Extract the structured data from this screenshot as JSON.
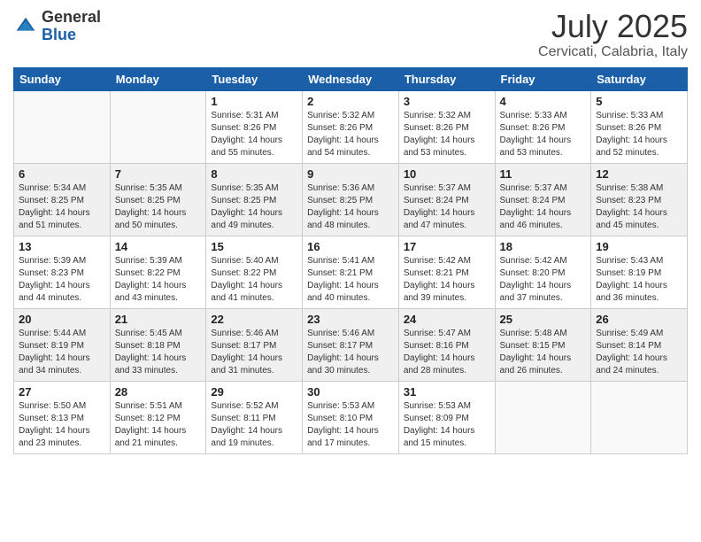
{
  "header": {
    "logo_general": "General",
    "logo_blue": "Blue",
    "month": "July 2025",
    "location": "Cervicati, Calabria, Italy"
  },
  "weekdays": [
    "Sunday",
    "Monday",
    "Tuesday",
    "Wednesday",
    "Thursday",
    "Friday",
    "Saturday"
  ],
  "weeks": [
    [
      {
        "day": "",
        "empty": true
      },
      {
        "day": "",
        "empty": true
      },
      {
        "day": "1",
        "sunrise": "5:31 AM",
        "sunset": "8:26 PM",
        "daylight": "14 hours and 55 minutes."
      },
      {
        "day": "2",
        "sunrise": "5:32 AM",
        "sunset": "8:26 PM",
        "daylight": "14 hours and 54 minutes."
      },
      {
        "day": "3",
        "sunrise": "5:32 AM",
        "sunset": "8:26 PM",
        "daylight": "14 hours and 53 minutes."
      },
      {
        "day": "4",
        "sunrise": "5:33 AM",
        "sunset": "8:26 PM",
        "daylight": "14 hours and 53 minutes."
      },
      {
        "day": "5",
        "sunrise": "5:33 AM",
        "sunset": "8:26 PM",
        "daylight": "14 hours and 52 minutes."
      }
    ],
    [
      {
        "day": "6",
        "sunrise": "5:34 AM",
        "sunset": "8:25 PM",
        "daylight": "14 hours and 51 minutes."
      },
      {
        "day": "7",
        "sunrise": "5:35 AM",
        "sunset": "8:25 PM",
        "daylight": "14 hours and 50 minutes."
      },
      {
        "day": "8",
        "sunrise": "5:35 AM",
        "sunset": "8:25 PM",
        "daylight": "14 hours and 49 minutes."
      },
      {
        "day": "9",
        "sunrise": "5:36 AM",
        "sunset": "8:25 PM",
        "daylight": "14 hours and 48 minutes."
      },
      {
        "day": "10",
        "sunrise": "5:37 AM",
        "sunset": "8:24 PM",
        "daylight": "14 hours and 47 minutes."
      },
      {
        "day": "11",
        "sunrise": "5:37 AM",
        "sunset": "8:24 PM",
        "daylight": "14 hours and 46 minutes."
      },
      {
        "day": "12",
        "sunrise": "5:38 AM",
        "sunset": "8:23 PM",
        "daylight": "14 hours and 45 minutes."
      }
    ],
    [
      {
        "day": "13",
        "sunrise": "5:39 AM",
        "sunset": "8:23 PM",
        "daylight": "14 hours and 44 minutes."
      },
      {
        "day": "14",
        "sunrise": "5:39 AM",
        "sunset": "8:22 PM",
        "daylight": "14 hours and 43 minutes."
      },
      {
        "day": "15",
        "sunrise": "5:40 AM",
        "sunset": "8:22 PM",
        "daylight": "14 hours and 41 minutes."
      },
      {
        "day": "16",
        "sunrise": "5:41 AM",
        "sunset": "8:21 PM",
        "daylight": "14 hours and 40 minutes."
      },
      {
        "day": "17",
        "sunrise": "5:42 AM",
        "sunset": "8:21 PM",
        "daylight": "14 hours and 39 minutes."
      },
      {
        "day": "18",
        "sunrise": "5:42 AM",
        "sunset": "8:20 PM",
        "daylight": "14 hours and 37 minutes."
      },
      {
        "day": "19",
        "sunrise": "5:43 AM",
        "sunset": "8:19 PM",
        "daylight": "14 hours and 36 minutes."
      }
    ],
    [
      {
        "day": "20",
        "sunrise": "5:44 AM",
        "sunset": "8:19 PM",
        "daylight": "14 hours and 34 minutes."
      },
      {
        "day": "21",
        "sunrise": "5:45 AM",
        "sunset": "8:18 PM",
        "daylight": "14 hours and 33 minutes."
      },
      {
        "day": "22",
        "sunrise": "5:46 AM",
        "sunset": "8:17 PM",
        "daylight": "14 hours and 31 minutes."
      },
      {
        "day": "23",
        "sunrise": "5:46 AM",
        "sunset": "8:17 PM",
        "daylight": "14 hours and 30 minutes."
      },
      {
        "day": "24",
        "sunrise": "5:47 AM",
        "sunset": "8:16 PM",
        "daylight": "14 hours and 28 minutes."
      },
      {
        "day": "25",
        "sunrise": "5:48 AM",
        "sunset": "8:15 PM",
        "daylight": "14 hours and 26 minutes."
      },
      {
        "day": "26",
        "sunrise": "5:49 AM",
        "sunset": "8:14 PM",
        "daylight": "14 hours and 24 minutes."
      }
    ],
    [
      {
        "day": "27",
        "sunrise": "5:50 AM",
        "sunset": "8:13 PM",
        "daylight": "14 hours and 23 minutes."
      },
      {
        "day": "28",
        "sunrise": "5:51 AM",
        "sunset": "8:12 PM",
        "daylight": "14 hours and 21 minutes."
      },
      {
        "day": "29",
        "sunrise": "5:52 AM",
        "sunset": "8:11 PM",
        "daylight": "14 hours and 19 minutes."
      },
      {
        "day": "30",
        "sunrise": "5:53 AM",
        "sunset": "8:10 PM",
        "daylight": "14 hours and 17 minutes."
      },
      {
        "day": "31",
        "sunrise": "5:53 AM",
        "sunset": "8:09 PM",
        "daylight": "14 hours and 15 minutes."
      },
      {
        "day": "",
        "empty": true
      },
      {
        "day": "",
        "empty": true
      }
    ]
  ]
}
